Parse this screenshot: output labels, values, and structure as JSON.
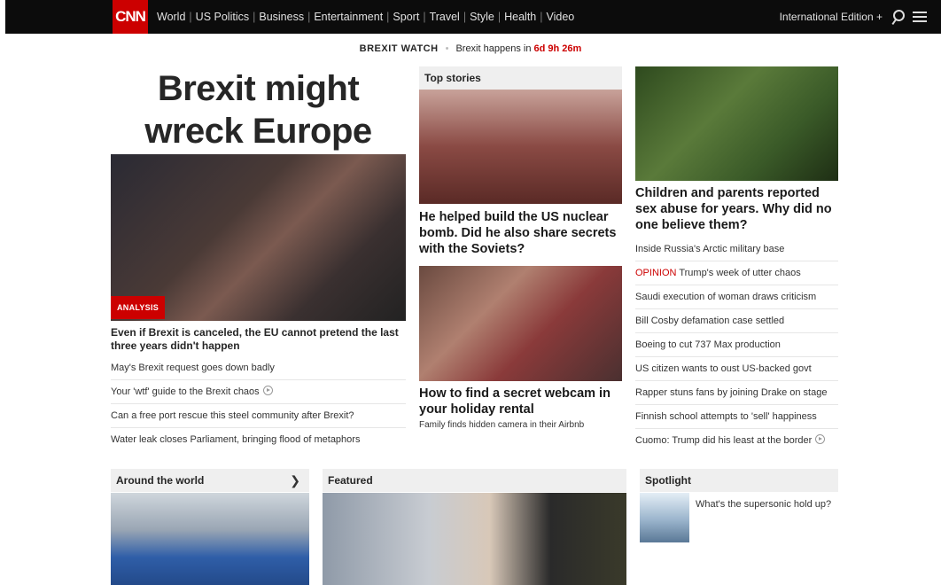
{
  "nav": {
    "logo": "CNN",
    "links": [
      "World",
      "US Politics",
      "Business",
      "Entertainment",
      "Sport",
      "Travel",
      "Style",
      "Health",
      "Video"
    ],
    "edition": "International Edition +"
  },
  "watch": {
    "label": "BREXIT WATCH",
    "text": "Brexit happens in",
    "countdown": "6d 9h 26m"
  },
  "lead": {
    "headline": "Brexit might wreck Europe",
    "badge": "ANALYSIS",
    "caption": "Even if Brexit is canceled, the EU cannot pretend the last three years didn't happen",
    "links": [
      "May's Brexit request goes down badly",
      "Your 'wtf' guide to the Brexit chaos",
      "Can a free port rescue this steel community after Brexit?",
      "Water leak closes Parliament, bringing flood of metaphors"
    ]
  },
  "top_stories": {
    "title": "Top stories",
    "story1": "He helped build the US nuclear bomb. Did he also share secrets with the Soviets?",
    "story2": "How to find a secret webcam in your holiday rental",
    "story2_sub": "Family finds hidden camera in their Airbnb"
  },
  "right": {
    "headline": "Children and parents reported sex abuse for years. Why did no one believe them?",
    "opinion_tag": "OPINION",
    "links": [
      "Inside Russia's Arctic military base",
      "Trump's week of utter chaos",
      "Saudi execution of woman draws criticism",
      "Bill Cosby defamation case settled",
      "Boeing to cut 737 Max production",
      "US citizen wants to oust US-backed govt",
      "Rapper stuns fans by joining Drake on stage",
      "Finnish school attempts to 'sell' happiness",
      "Cuomo: Trump did his least at the border"
    ]
  },
  "bottom": {
    "around": "Around the world",
    "featured": "Featured",
    "spotlight": "Spotlight",
    "spotlight_text": "What's the supersonic hold up?"
  },
  "colors": {
    "brand_red": "#cc0000",
    "nav_bg": "#0c0c0c"
  }
}
